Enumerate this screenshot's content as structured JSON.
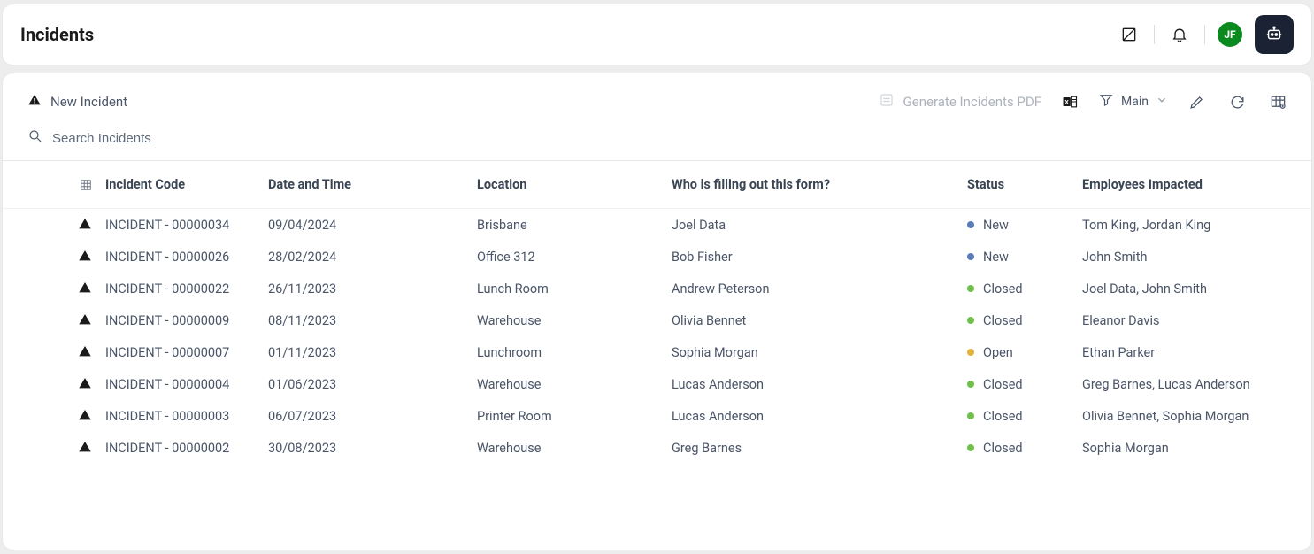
{
  "header": {
    "title": "Incidents",
    "avatar_initials": "JF"
  },
  "toolbar": {
    "new_label": "New Incident",
    "generate_pdf_label": "Generate Incidents PDF",
    "filter_label": "Main"
  },
  "search": {
    "placeholder": "Search Incidents"
  },
  "table": {
    "columns": {
      "code": "Incident Code",
      "datetime": "Date and Time",
      "location": "Location",
      "filler": "Who is filling out this form?",
      "status": "Status",
      "impacted": "Employees Impacted"
    },
    "rows": [
      {
        "code": "INCIDENT - 00000034",
        "datetime": "09/04/2024",
        "location": "Brisbane",
        "filler": "Joel Data",
        "status": "New",
        "impacted": "Tom King, Jordan King",
        "status_color": "#5b7ab8"
      },
      {
        "code": "INCIDENT - 00000026",
        "datetime": "28/02/2024",
        "location": "Office 312",
        "filler": "Bob Fisher",
        "status": "New",
        "impacted": "John Smith",
        "status_color": "#5b7ab8"
      },
      {
        "code": "INCIDENT - 00000022",
        "datetime": "26/11/2023",
        "location": "Lunch Room",
        "filler": "Andrew Peterson",
        "status": "Closed",
        "impacted": "Joel Data, John Smith",
        "status_color": "#6fbf4a"
      },
      {
        "code": "INCIDENT - 00000009",
        "datetime": "08/11/2023",
        "location": "Warehouse",
        "filler": "Olivia Bennet",
        "status": "Closed",
        "impacted": "Eleanor Davis",
        "status_color": "#6fbf4a"
      },
      {
        "code": "INCIDENT - 00000007",
        "datetime": "01/11/2023",
        "location": "Lunchroom",
        "filler": "Sophia Morgan",
        "status": "Open",
        "impacted": "Ethan Parker",
        "status_color": "#e3b23c"
      },
      {
        "code": "INCIDENT - 00000004",
        "datetime": "01/06/2023",
        "location": "Warehouse",
        "filler": "Lucas Anderson",
        "status": "Closed",
        "impacted": "Greg Barnes, Lucas Anderson",
        "status_color": "#6fbf4a"
      },
      {
        "code": "INCIDENT - 00000003",
        "datetime": "06/07/2023",
        "location": "Printer Room",
        "filler": "Lucas Anderson",
        "status": "Closed",
        "impacted": "Olivia Bennet, Sophia Morgan",
        "status_color": "#6fbf4a"
      },
      {
        "code": "INCIDENT - 00000002",
        "datetime": "30/08/2023",
        "location": "Warehouse",
        "filler": "Greg Barnes",
        "status": "Closed",
        "impacted": "Sophia Morgan",
        "status_color": "#6fbf4a"
      }
    ]
  }
}
